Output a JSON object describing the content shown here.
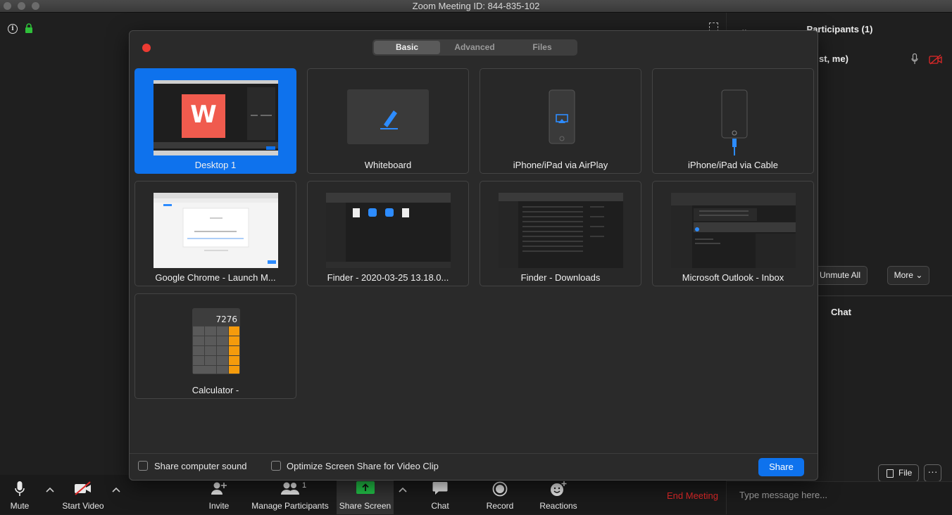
{
  "window": {
    "title": "Zoom Meeting ID: 844-835-102"
  },
  "participants_panel": {
    "title": "Participants (1)",
    "participant_name": "st, me)",
    "unmute_all": "Unmute All",
    "more": "More",
    "chat_title": "Chat",
    "file_button": "File",
    "more_dots": "···",
    "message_placeholder": "Type message here..."
  },
  "share_dialog": {
    "tabs": [
      "Basic",
      "Advanced",
      "Files"
    ],
    "selected_tab": "Basic",
    "tiles": [
      {
        "label": "Desktop 1",
        "selected": true
      },
      {
        "label": "Whiteboard"
      },
      {
        "label": "iPhone/iPad via AirPlay"
      },
      {
        "label": "iPhone/iPad via Cable"
      },
      {
        "label": "Google Chrome - Launch M..."
      },
      {
        "label": "Finder - 2020-03-25 13.18.0..."
      },
      {
        "label": "Finder - Downloads"
      },
      {
        "label": "Microsoft Outlook - Inbox"
      },
      {
        "label": "Calculator -"
      }
    ],
    "calculator_display": "7276",
    "share_sound_label": "Share computer sound",
    "optimize_label": "Optimize Screen Share for Video Clip",
    "share_button": "Share"
  },
  "toolbar": {
    "mute": "Mute",
    "start_video": "Start Video",
    "invite": "Invite",
    "manage_participants": "Manage Participants",
    "participant_count": "1",
    "share_screen": "Share Screen",
    "chat": "Chat",
    "record": "Record",
    "reactions": "Reactions",
    "end_meeting": "End Meeting"
  },
  "colors": {
    "accent": "#0e72ed",
    "end_meeting": "#e02828",
    "share_green": "#22c348",
    "close_red": "#ed3b32"
  }
}
